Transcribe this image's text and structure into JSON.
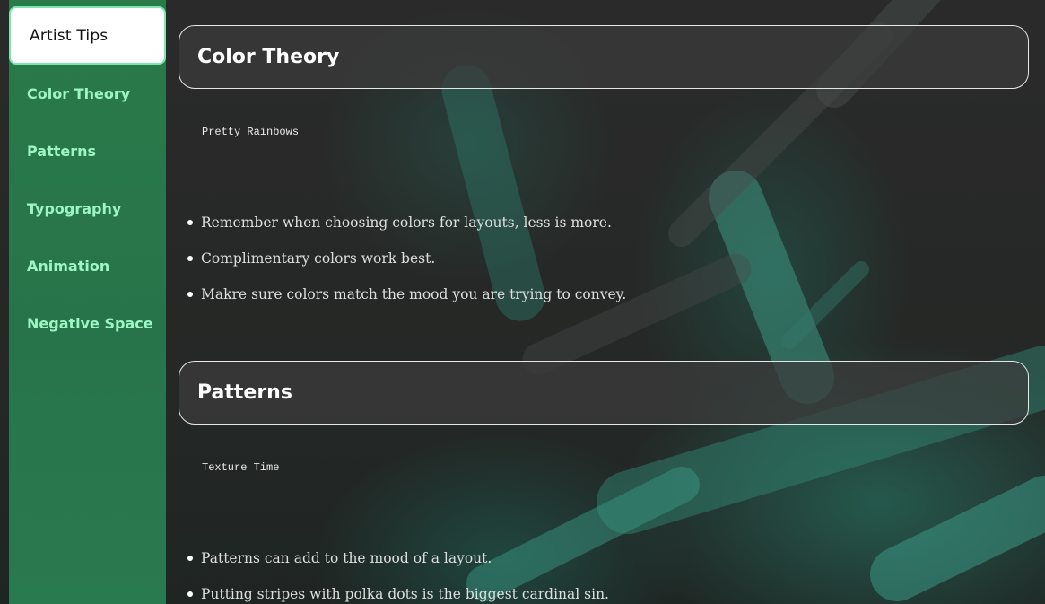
{
  "sidebar": {
    "brand": "Artist Tips",
    "items": [
      {
        "label": "Color Theory"
      },
      {
        "label": "Patterns"
      },
      {
        "label": "Typography"
      },
      {
        "label": "Animation"
      },
      {
        "label": "Negative Space"
      }
    ]
  },
  "sections": [
    {
      "title": "Color Theory",
      "subtitle": "Pretty Rainbows",
      "tips": [
        "Remember when choosing colors for layouts, less is more.",
        "Complimentary colors work best.",
        "Makre sure colors match the mood you are trying to convey."
      ]
    },
    {
      "title": "Patterns",
      "subtitle": "Texture Time",
      "tips": [
        "Patterns can add to the mood of a layout.",
        "Putting stripes with polka dots is the biggest cardinal sin."
      ]
    }
  ],
  "colors": {
    "sidebar": "#2a7a4a",
    "nav_text": "#9ef5c4",
    "brand_border": "#7be6b0"
  }
}
